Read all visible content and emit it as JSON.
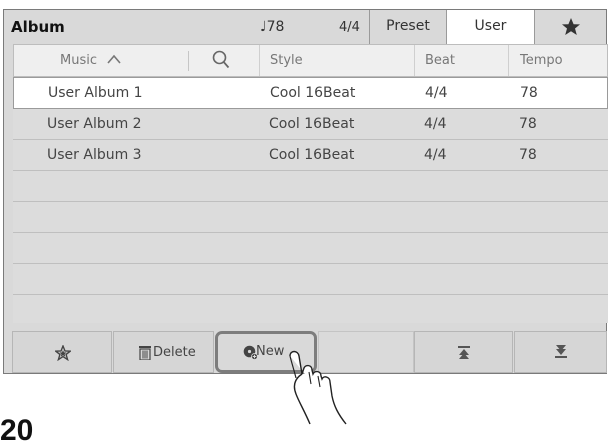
{
  "header": {
    "title": "Album",
    "tempo": "♩78",
    "beat": "4/4",
    "tabs": {
      "preset": "Preset",
      "user": "User",
      "favorite_icon": "star-icon"
    }
  },
  "table": {
    "columns": {
      "music": "Music",
      "style": "Style",
      "beat": "Beat",
      "tempo": "Tempo"
    },
    "rows": [
      {
        "music": "User Album 1",
        "style": "Cool 16Beat",
        "beat": "4/4",
        "tempo": "78"
      },
      {
        "music": "User Album 2",
        "style": "Cool 16Beat",
        "beat": "4/4",
        "tempo": "78"
      },
      {
        "music": "User Album 3",
        "style": "Cool 16Beat",
        "beat": "4/4",
        "tempo": "78"
      }
    ]
  },
  "toolbar": {
    "delete_label": "Delete",
    "new_label": "New"
  },
  "footer_number": "20"
}
